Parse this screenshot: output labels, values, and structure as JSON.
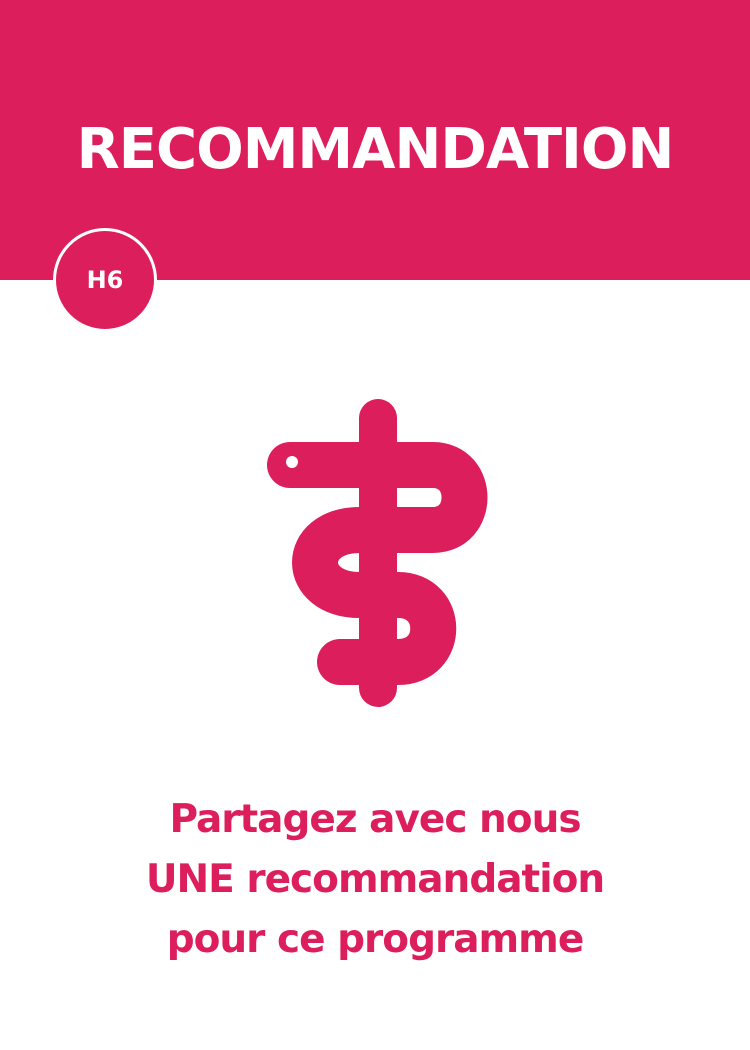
{
  "card": {
    "title": "RECOMMANDATION",
    "code": "H6",
    "emblem_icon": "caduceus-snake-icon",
    "message_lines": [
      "Partagez avec nous",
      "UNE recommandation",
      "pour ce programme"
    ]
  },
  "colors": {
    "accent": "#dc1e5c",
    "background": "#ffffff",
    "title_text": "#ffffff"
  }
}
